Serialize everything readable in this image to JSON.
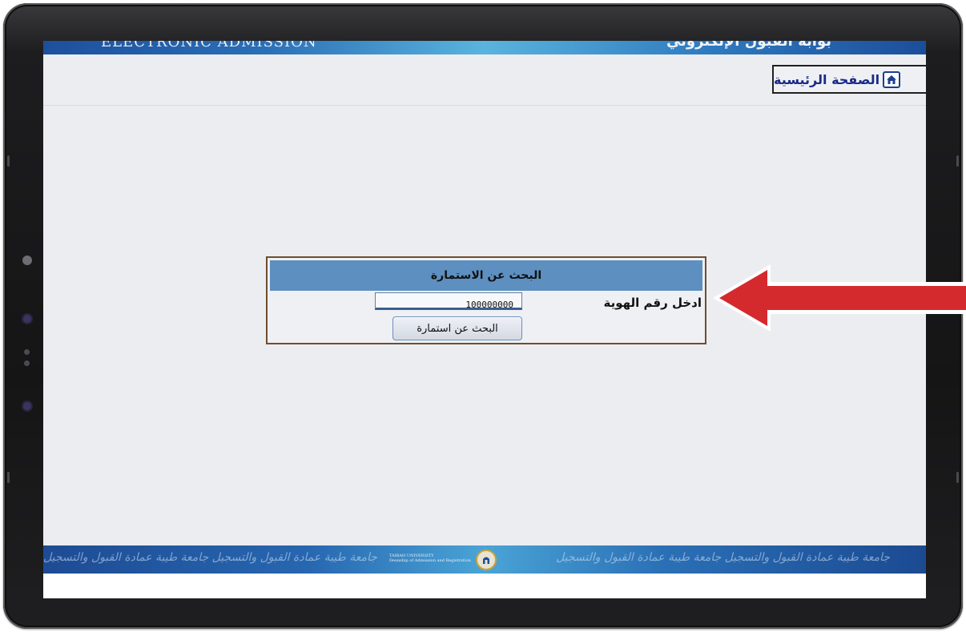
{
  "header": {
    "banner_left": "ELECTRONIC ADMISSION",
    "banner_right": "بوابة القبول الإلكتروني"
  },
  "nav": {
    "home_label": "الصفحة الرئيسية"
  },
  "search_panel": {
    "title": "البحث عن الاستمارة",
    "id_label": "ادخل رقم الهوية",
    "id_value": "100000000",
    "button_label": "البحث عن استمارة"
  },
  "footer": {
    "calligraphy": "جامعة طيبة عمادة القبول والتسجيل جامعة طيبة عمادة القبول والتسجيل",
    "logo_text_line1": "TAIBAH UNIVERSITY",
    "logo_text_line2": "Deanship of Admission and Registration"
  },
  "colors": {
    "panel_header": "#5d8fc0",
    "panel_border": "#6e4e2e",
    "arrow": "#d42a2e",
    "home_text": "#1a2a8a"
  },
  "icons": {
    "home": "home-icon",
    "annotation": "arrow-left-icon"
  }
}
